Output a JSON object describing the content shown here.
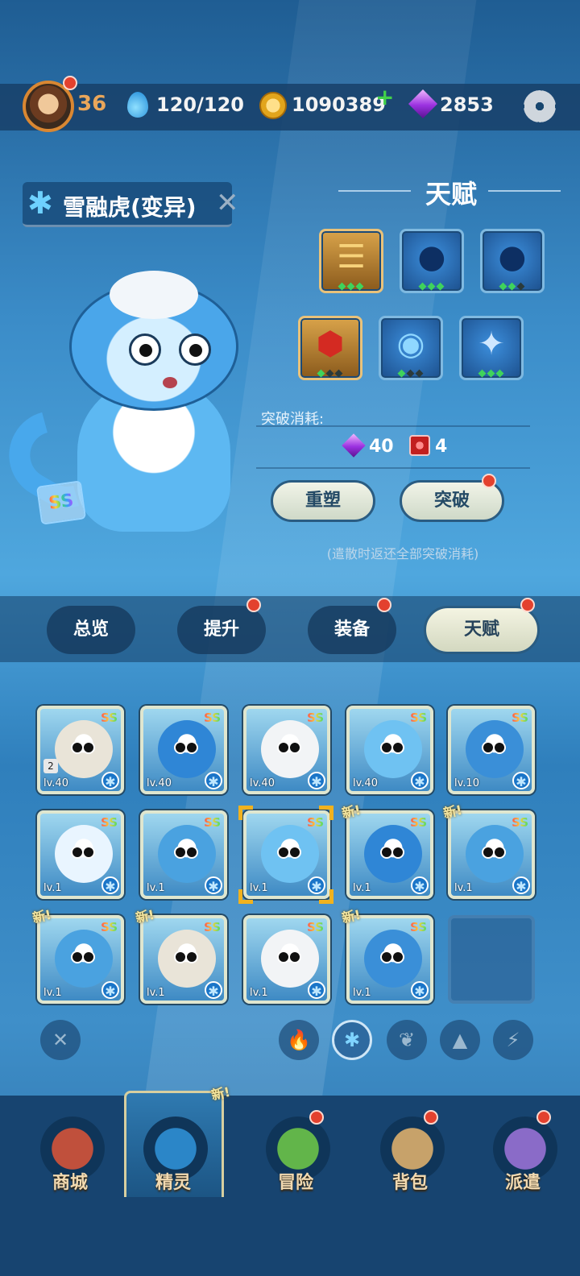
{
  "topbar": {
    "level": "36",
    "stamina": "120/120",
    "coins": "1090389",
    "coins_add": "+",
    "gems": "2853",
    "icons": [
      "avatar",
      "water-drop-icon",
      "paw-coin-icon",
      "purple-gem-icon",
      "gear-icon"
    ]
  },
  "pet": {
    "name": "雪融虎(变异)",
    "grade": "SS",
    "element_icon": "snowflake-icon"
  },
  "talent": {
    "title": "天赋",
    "slots": [
      {
        "icon": "gold-stack-icon",
        "style": "gold",
        "pips": [
          1,
          1,
          1
        ]
      },
      {
        "icon": "blue-drop-icon",
        "style": "blue",
        "pips": [
          1,
          1,
          1
        ]
      },
      {
        "icon": "blue-drop-icon",
        "style": "blue",
        "pips": [
          1,
          1,
          0
        ]
      },
      {
        "icon": "red-hex-icon",
        "style": "red",
        "pips": [
          1,
          0,
          0
        ]
      },
      {
        "icon": "eye-icon",
        "style": "blue",
        "pips": [
          1,
          0,
          0
        ]
      },
      {
        "icon": "sparkle-icon",
        "style": "blue",
        "pips": [
          1,
          1,
          1
        ]
      }
    ],
    "breakthrough_label": "突破消耗:",
    "cost_gem": "40",
    "cost_item": "4",
    "reshape_button": "重塑",
    "breakthrough_button": "突破",
    "hint": "(遣散时返还全部突破消耗)"
  },
  "tabs": [
    {
      "label": "总览",
      "badge": false,
      "active": false
    },
    {
      "label": "提升",
      "badge": true,
      "active": false
    },
    {
      "label": "装备",
      "badge": true,
      "active": false
    },
    {
      "label": "天赋",
      "badge": true,
      "active": true
    }
  ],
  "grid": [
    {
      "grade": "SS",
      "level": "lv.40",
      "qty": "2",
      "new": false,
      "color": "#e9e4d8"
    },
    {
      "grade": "SS",
      "level": "lv.40",
      "qty": "",
      "new": false,
      "color": "#2f86d6"
    },
    {
      "grade": "SS",
      "level": "lv.40",
      "qty": "",
      "new": false,
      "color": "#f2f4f6"
    },
    {
      "grade": "SS",
      "level": "lv.40",
      "qty": "",
      "new": false,
      "color": "#6fc2f2"
    },
    {
      "grade": "SS",
      "level": "lv.10",
      "qty": "",
      "new": false,
      "color": "#3a8fd8"
    },
    {
      "grade": "SS",
      "level": "lv.1",
      "qty": "",
      "new": false,
      "color": "#e9f5ff"
    },
    {
      "grade": "SS",
      "level": "lv.1",
      "qty": "",
      "new": false,
      "color": "#4aa2e0"
    },
    {
      "grade": "SS",
      "level": "lv.1",
      "qty": "",
      "new": false,
      "color": "#6fc2f2",
      "selected": true
    },
    {
      "grade": "SS",
      "level": "lv.1",
      "qty": "",
      "new": true,
      "color": "#2f86d6"
    },
    {
      "grade": "SS",
      "level": "lv.1",
      "qty": "",
      "new": true,
      "color": "#4aa2e0"
    },
    {
      "grade": "SS",
      "level": "lv.1",
      "qty": "",
      "new": true,
      "color": "#4aa2e0"
    },
    {
      "grade": "SS",
      "level": "lv.1",
      "qty": "",
      "new": true,
      "color": "#e9e4d8"
    },
    {
      "grade": "SS",
      "level": "lv.1",
      "qty": "",
      "new": false,
      "color": "#f2f4f6"
    },
    {
      "grade": "SS",
      "level": "lv.1",
      "qty": "",
      "new": true,
      "color": "#3a8fd8"
    }
  ],
  "new_tag": "新!",
  "filters": [
    {
      "icon": "clear-x-icon",
      "glyph": "✕",
      "on": false
    },
    {
      "icon": "fire-icon",
      "glyph": "🔥",
      "on": false
    },
    {
      "icon": "snowflake-icon",
      "glyph": "✱",
      "on": true
    },
    {
      "icon": "leaf-icon",
      "glyph": "❦",
      "on": false
    },
    {
      "icon": "rock-icon",
      "glyph": "▲",
      "on": false
    },
    {
      "icon": "lightning-icon",
      "glyph": "⚡",
      "on": false
    }
  ],
  "nav": [
    {
      "label": "商城",
      "icon": "shop-icon",
      "badge": false,
      "active": false
    },
    {
      "label": "精灵",
      "icon": "spirit-swirl-icon",
      "badge": false,
      "active": true,
      "new": "新!"
    },
    {
      "label": "冒险",
      "icon": "mountain-icon",
      "badge": true,
      "active": false
    },
    {
      "label": "背包",
      "icon": "backpack-icon",
      "badge": true,
      "active": false
    },
    {
      "label": "派遣",
      "icon": "map-pin-icon",
      "badge": true,
      "active": false
    }
  ]
}
